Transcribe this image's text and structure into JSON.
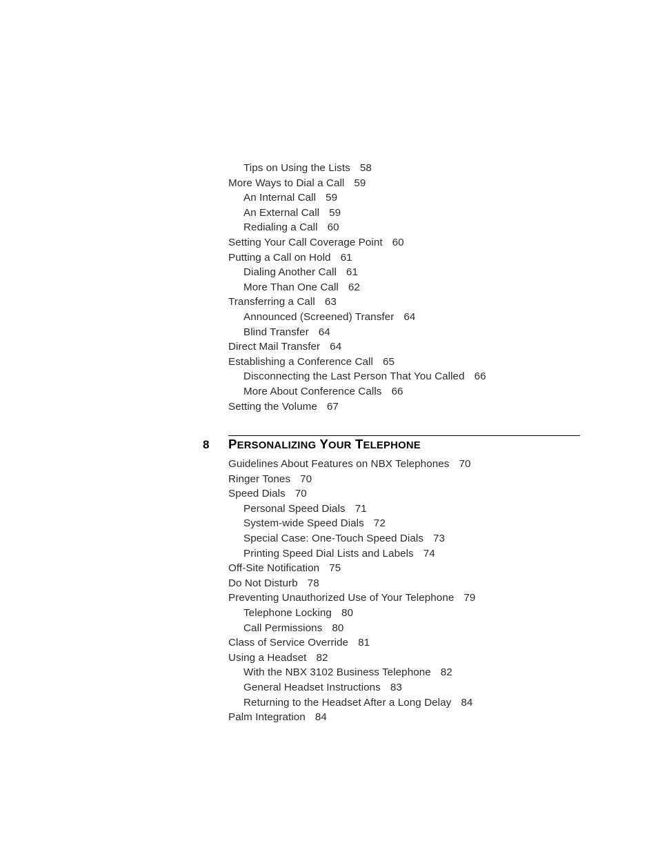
{
  "document": {
    "type": "table-of-contents",
    "background_color": "#ffffff",
    "text_color": "#2b2b2b",
    "heading_color": "#000000"
  },
  "toc_section_1": {
    "entries": [
      {
        "title": "Tips on Using the Lists",
        "page": "58",
        "level": 2
      },
      {
        "title": "More Ways to Dial a Call",
        "page": "59",
        "level": 1
      },
      {
        "title": "An Internal Call",
        "page": "59",
        "level": 2
      },
      {
        "title": "An External Call",
        "page": "59",
        "level": 2
      },
      {
        "title": "Redialing a Call",
        "page": "60",
        "level": 2
      },
      {
        "title": "Setting Your Call Coverage Point",
        "page": "60",
        "level": 1
      },
      {
        "title": "Putting a Call on Hold",
        "page": "61",
        "level": 1
      },
      {
        "title": "Dialing Another Call",
        "page": "61",
        "level": 2
      },
      {
        "title": "More Than One Call",
        "page": "62",
        "level": 2
      },
      {
        "title": "Transferring a Call",
        "page": "63",
        "level": 1
      },
      {
        "title": "Announced (Screened) Transfer",
        "page": "64",
        "level": 2
      },
      {
        "title": "Blind Transfer",
        "page": "64",
        "level": 2
      },
      {
        "title": "Direct Mail Transfer",
        "page": "64",
        "level": 1
      },
      {
        "title": "Establishing a Conference Call",
        "page": "65",
        "level": 1
      },
      {
        "title": "Disconnecting the Last Person That You Called",
        "page": "66",
        "level": 2
      },
      {
        "title": "More About Conference Calls",
        "page": "66",
        "level": 2
      },
      {
        "title": "Setting the Volume",
        "page": "67",
        "level": 1
      }
    ]
  },
  "chapter": {
    "number": "8",
    "title": "Personalizing Your Telephone",
    "title_words": [
      {
        "cap": "P",
        "rest": "ERSONALIZING"
      },
      {
        "cap": "Y",
        "rest": "OUR"
      },
      {
        "cap": "T",
        "rest": "ELEPHONE"
      }
    ]
  },
  "toc_section_2": {
    "entries": [
      {
        "title": "Guidelines About Features on NBX Telephones",
        "page": "70",
        "level": 1
      },
      {
        "title": "Ringer Tones",
        "page": "70",
        "level": 1
      },
      {
        "title": "Speed Dials",
        "page": "70",
        "level": 1
      },
      {
        "title": "Personal Speed Dials",
        "page": "71",
        "level": 2
      },
      {
        "title": "System-wide Speed Dials",
        "page": "72",
        "level": 2
      },
      {
        "title": "Special Case: One-Touch Speed Dials",
        "page": "73",
        "level": 2
      },
      {
        "title": "Printing Speed Dial Lists and Labels",
        "page": "74",
        "level": 2
      },
      {
        "title": "Off-Site Notification",
        "page": "75",
        "level": 1
      },
      {
        "title": "Do Not Disturb",
        "page": "78",
        "level": 1
      },
      {
        "title": "Preventing Unauthorized Use of Your Telephone",
        "page": "79",
        "level": 1
      },
      {
        "title": "Telephone Locking",
        "page": "80",
        "level": 2
      },
      {
        "title": "Call Permissions",
        "page": "80",
        "level": 2
      },
      {
        "title": "Class of Service Override",
        "page": "81",
        "level": 1
      },
      {
        "title": "Using a Headset",
        "page": "82",
        "level": 1
      },
      {
        "title": "With the NBX 3102 Business Telephone",
        "page": "82",
        "level": 2
      },
      {
        "title": "General Headset Instructions",
        "page": "83",
        "level": 2
      },
      {
        "title": "Returning to the Headset After a Long Delay",
        "page": "84",
        "level": 2
      },
      {
        "title": "Palm Integration",
        "page": "84",
        "level": 1
      }
    ]
  }
}
